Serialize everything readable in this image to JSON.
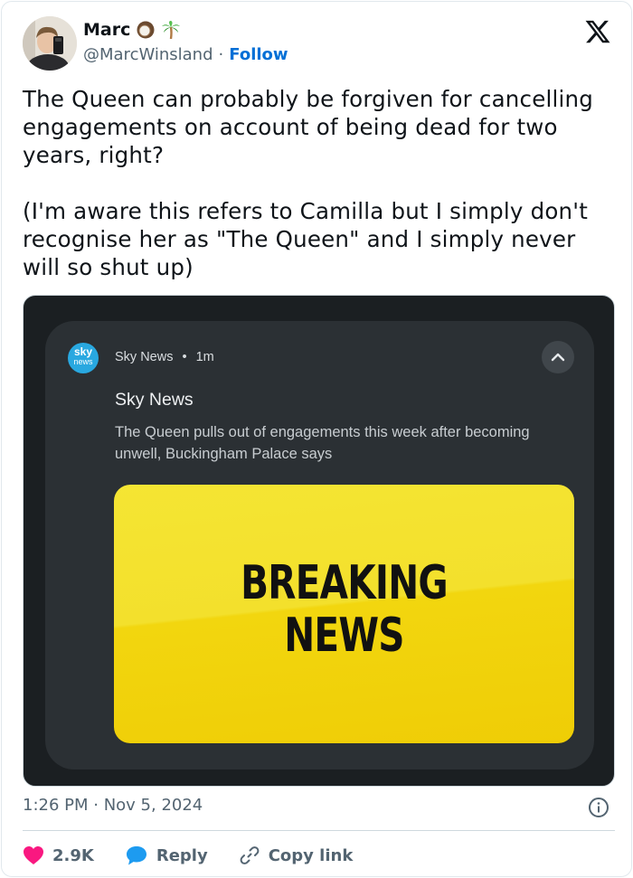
{
  "user": {
    "display_name": "Marc",
    "emojis": [
      "coconut-icon",
      "palm-tree-icon"
    ],
    "handle": "@MarcWinsland",
    "separator": "·",
    "follow_label": "Follow"
  },
  "tweet": {
    "text": "The Queen can probably be forgiven for cancelling engagements on account of being dead for two years, right?\n\n(I'm aware this refers to Camilla but I simply don't recognise her as \"The Queen\" and I simply never will so shut up)"
  },
  "media": {
    "notification": {
      "app_icon_line1": "sky",
      "app_icon_line2": "news",
      "app_name": "Sky News",
      "dot": "•",
      "age": "1m",
      "title": "Sky News",
      "body": "The Queen pulls out of engagements this week after becoming unwell, Buckingham Palace says",
      "image_line1": "BREAKING",
      "image_line2": "NEWS"
    }
  },
  "footer": {
    "timestamp": "1:26 PM · Nov 5, 2024",
    "likes": "2.9K",
    "reply_label": "Reply",
    "copy_label": "Copy link"
  },
  "colors": {
    "accent": "#006fd6",
    "like": "#f91880",
    "reply": "#1d9bf0",
    "breaking_yellow": "#f2d60f"
  }
}
